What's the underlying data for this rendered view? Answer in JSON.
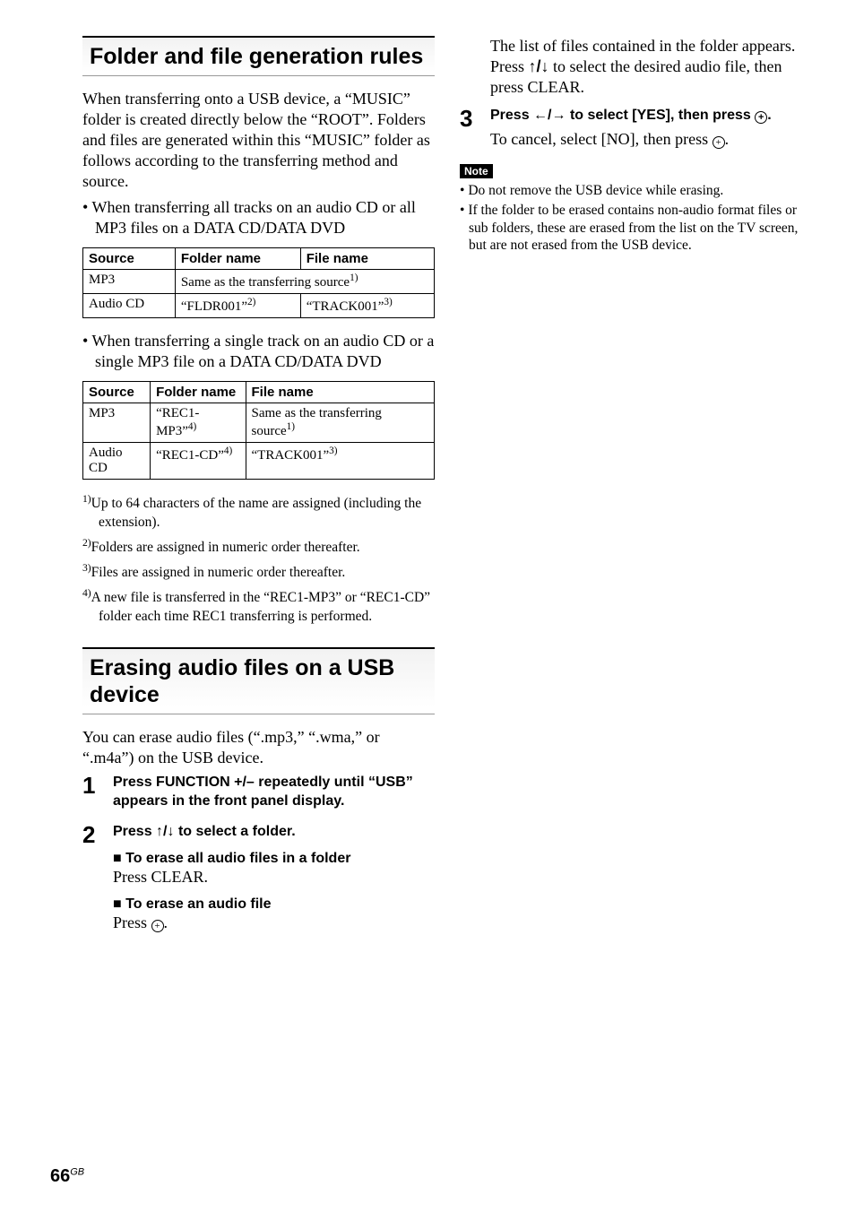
{
  "page_number": "66",
  "page_region": "GB",
  "left": {
    "section1_title": "Folder and file generation rules",
    "intro": "When transferring onto a USB device, a “MUSIC” folder is created directly below the “ROOT”. Folders and files are generated within this “MUSIC” folder as follows according to the transferring method and source.",
    "bullet1": "When transferring all tracks on an audio CD or all MP3 files on a DATA CD/DATA DVD",
    "table1": {
      "headers": [
        "Source",
        "Folder name",
        "File name"
      ],
      "rows": [
        {
          "source": "MP3",
          "merged": "Same as the transferring source",
          "merged_sup": "1)"
        },
        {
          "source": "Audio CD",
          "folder": "“FLDR001”",
          "folder_sup": "2)",
          "file": "“TRACK001”",
          "file_sup": "3)"
        }
      ]
    },
    "bullet2": "When transferring a single track on an audio CD or a single MP3 file on a DATA CD/DATA DVD",
    "table2": {
      "headers": [
        "Source",
        "Folder name",
        "File name"
      ],
      "rows": [
        {
          "source": "MP3",
          "folder": "“REC1-MP3”",
          "folder_sup": "4)",
          "file": "Same as the transferring source",
          "file_sup": "1)"
        },
        {
          "source": "Audio CD",
          "folder": "“REC1-CD”",
          "folder_sup": "4)",
          "file": "“TRACK001”",
          "file_sup": "3)"
        }
      ]
    },
    "footnotes": [
      {
        "num": "1)",
        "text": "Up to 64 characters of the name are assigned (including the extension)."
      },
      {
        "num": "2)",
        "text": "Folders are assigned in numeric order thereafter."
      },
      {
        "num": "3)",
        "text": "Files are assigned in numeric order thereafter."
      },
      {
        "num": "4)",
        "text": "A new file is transferred in the “REC1-MP3” or “REC1-CD” folder each time REC1 transferring is performed."
      }
    ],
    "section2_title": "Erasing audio files on a USB device",
    "section2_intro": "You can erase audio files (“.mp3,” “.wma,” or “.m4a”) on the USB device.",
    "step1_instruction": "Press FUNCTION +/– repeatedly until “USB” appears in the front panel display.",
    "step2_instruction_prefix": "Press ",
    "step2_instruction_suffix": " to select a folder.",
    "step2_sub1_title": "To erase all audio files in a folder",
    "step2_sub1_text": "Press CLEAR.",
    "step2_sub2_title": "To erase an audio file",
    "step2_sub2_text_prefix": "Press ",
    "step2_sub2_text_suffix": "."
  },
  "right": {
    "cont1": "The list of files contained in the folder appears.",
    "cont2_prefix": "Press ",
    "cont2_suffix": " to select the desired audio file, then press CLEAR.",
    "step3_instruction_prefix": "Press ",
    "step3_instruction_mid": " to select [YES], then press ",
    "step3_instruction_suffix": ".",
    "step3_text_prefix": "To cancel, select [NO], then press ",
    "step3_text_suffix": ".",
    "note_label": "Note",
    "notes": [
      "Do not remove the USB device while erasing.",
      "If the folder to be erased contains non-audio format files or sub folders, these are erased from the list on the TV screen, but are not erased from the USB device."
    ]
  }
}
